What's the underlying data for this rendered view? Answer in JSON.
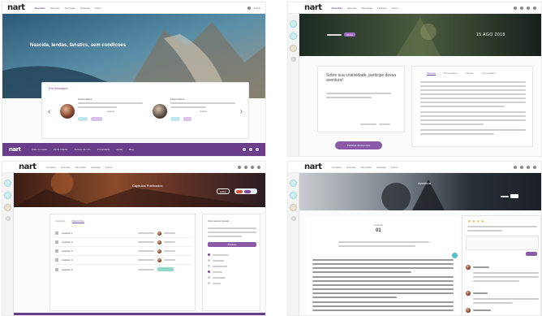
{
  "brand": {
    "logo": "nart",
    "accent": "#7d4b9c",
    "teal": "#4fc1c8"
  },
  "p1": {
    "nav": {
      "items": [
        "Novelties",
        "Histories",
        "Storyteller",
        "Fantasia",
        "Sobre"
      ],
      "login": "Entrar"
    },
    "hero": {
      "title": "Nascida, lendas, fanstics, sem condicoes"
    },
    "section": {
      "heading": "Em destaque"
    },
    "cards": [
      {
        "title": "Lorem ipsum",
        "author": "Autora"
      },
      {
        "title": "Lorem ipsum",
        "author": "Autora"
      }
    ],
    "footer": {
      "logo": "nart",
      "links": [
        "Fale Conosco",
        "Perfil Criador",
        "Termos de Uso",
        "Privacidade",
        "Ajuda",
        "Blog"
      ]
    }
  },
  "p2": {
    "nav": {
      "items": [
        "Novelties",
        "Histories",
        "Storyteller",
        "Fantasia",
        "Sobre"
      ]
    },
    "hero": {
      "chip": "Mono",
      "date": "15 AGO 2018"
    },
    "left": {
      "title": "Sobre sua criatividade, participe dessa aventura!",
      "button": "Participe da Aventura"
    },
    "tabs": [
      "Sinopse",
      "Personagens",
      "Mundo",
      "Comentarios"
    ]
  },
  "p3": {
    "nav": {
      "items": [
        "Novelties",
        "Histories",
        "Storyteller",
        "Fantasia",
        "Sobre"
      ]
    },
    "hero": {
      "title": "Capitulos Publicados",
      "button": "Editar"
    },
    "tabs": [
      "Capitulos",
      "Rascunhos"
    ],
    "rows": [
      "Capitulo 1",
      "Capitulo 2",
      "Capitulo 3",
      "Capitulo 4",
      "Capitulo 5"
    ],
    "sidebar": {
      "title": "Informacoes Gerais",
      "button": "Publicar"
    }
  },
  "p4": {
    "nav": {
      "items": [
        "Novelties",
        "Histories",
        "Storyteller",
        "Fantasia",
        "Sobre"
      ]
    },
    "chapter": {
      "label": "Capitulo",
      "number": "01"
    },
    "hero": {
      "title": "Aventura"
    }
  }
}
